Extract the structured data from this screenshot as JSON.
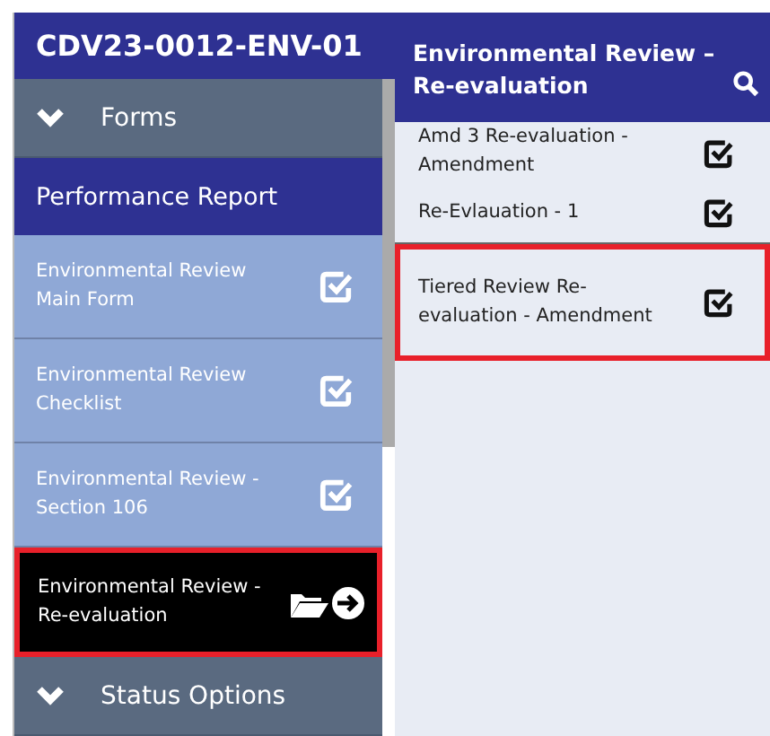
{
  "left_panel": {
    "title": "CDV23-0012-ENV-01",
    "sections": [
      {
        "label": "Forms",
        "expanded": true,
        "group": "Performance Report",
        "items": [
          {
            "label": "Environmental Review\nMain Form",
            "selected": false
          },
          {
            "label": "Environmental Review\nChecklist",
            "selected": false
          },
          {
            "label": "Environmental Review -\nSection 106",
            "selected": false
          },
          {
            "label": "Environmental Review -\nRe-evaluation",
            "selected": true
          }
        ]
      },
      {
        "label": "Status Options",
        "expanded": true
      }
    ]
  },
  "right_panel": {
    "title": "Environmental Review –\nRe-evaluation",
    "items": [
      {
        "label": "Amd 3 Re-evaluation -\nAmendment",
        "selected": false
      },
      {
        "label": "Re-Evlauation - 1",
        "selected": false
      },
      {
        "label": "Tiered Review Re-\nevaluation - Amendment",
        "selected": true
      }
    ]
  }
}
